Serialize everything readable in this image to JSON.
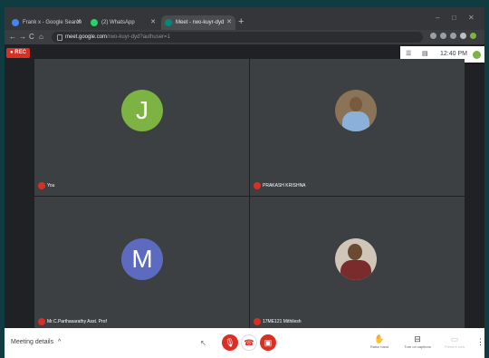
{
  "browser": {
    "tabs": [
      {
        "label": "Frank x - Google Search",
        "color": "#4285f4"
      },
      {
        "label": "(2) WhatsApp",
        "color": "#25d366"
      },
      {
        "label": "Meet - rwo-kuyr-dyd",
        "color": "#00897b"
      }
    ],
    "new_tab": "+",
    "window_controls": [
      "–",
      "□",
      "✕"
    ],
    "nav": {
      "back": "←",
      "forward": "→",
      "reload": "C",
      "home": "⌂"
    },
    "url_domain": "meet.google.com",
    "url_path": "/rwo-kuyr-dyd?authuser=1"
  },
  "meet": {
    "rec_label": "● REC",
    "time": "12:40 PM",
    "participants": [
      {
        "initial": "J",
        "name": "You",
        "avatar_color": "#7cb342"
      },
      {
        "initial": "",
        "name": "PRAKASH KRISHNA"
      },
      {
        "initial": "M",
        "name": "Mr.C.Parthasarathy Asst. Prof",
        "avatar_color": "#5c6bc0"
      },
      {
        "initial": "",
        "name": "17ME121 Mithilesh"
      }
    ],
    "bottom": {
      "meeting_details": "Meeting details",
      "meeting_details_chevron": "^",
      "raise_hand": "Raise hand",
      "captions": "Turn on captions",
      "present": "Present now"
    }
  }
}
